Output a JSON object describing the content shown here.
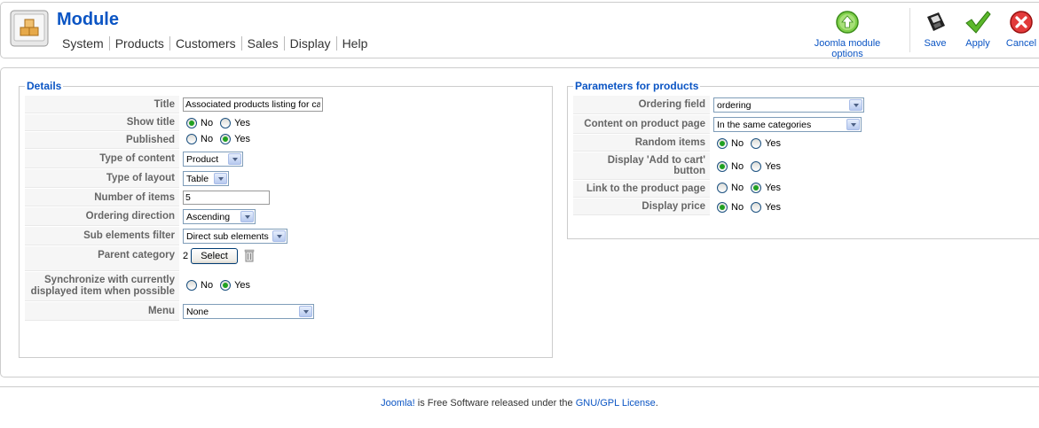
{
  "header": {
    "title": "Module",
    "menu": [
      "System",
      "Products",
      "Customers",
      "Sales",
      "Display",
      "Help"
    ]
  },
  "toolbar": {
    "options_label": "Joomla module options",
    "save_label": "Save",
    "apply_label": "Apply",
    "cancel_label": "Cancel"
  },
  "details": {
    "legend": "Details",
    "title_label": "Title",
    "title_value": "Associated products listing for cat",
    "show_title_label": "Show title",
    "published_label": "Published",
    "type_content_label": "Type of content",
    "type_content_value": "Product",
    "type_layout_label": "Type of layout",
    "type_layout_value": "Table",
    "num_items_label": "Number of items",
    "num_items_value": "5",
    "ordering_dir_label": "Ordering direction",
    "ordering_dir_value": "Ascending",
    "sub_filter_label": "Sub elements filter",
    "sub_filter_value": "Direct sub elements",
    "parent_cat_label": "Parent category",
    "parent_cat_value": "2",
    "select_label": "Select",
    "sync_label_1": "Synchronize with currently",
    "sync_label_2": "displayed item when possible",
    "menu_label": "Menu",
    "menu_value": "None",
    "no": "No",
    "yes": "Yes"
  },
  "params": {
    "legend": "Parameters for products",
    "ordering_field_label": "Ordering field",
    "ordering_field_value": "ordering",
    "content_page_label": "Content on product page",
    "content_page_value": "In the same categories",
    "random_label": "Random items",
    "add_cart_label": "Display 'Add to cart' button",
    "link_page_label": "Link to the product page",
    "display_price_label": "Display price",
    "no": "No",
    "yes": "Yes"
  },
  "footer": {
    "joomla_link": "Joomla!",
    "text": " is Free Software released under the ",
    "license_link": "GNU/GPL License",
    "end": "."
  },
  "colors": {
    "accent": "#0b55c4",
    "radio_on": "#21a121"
  }
}
